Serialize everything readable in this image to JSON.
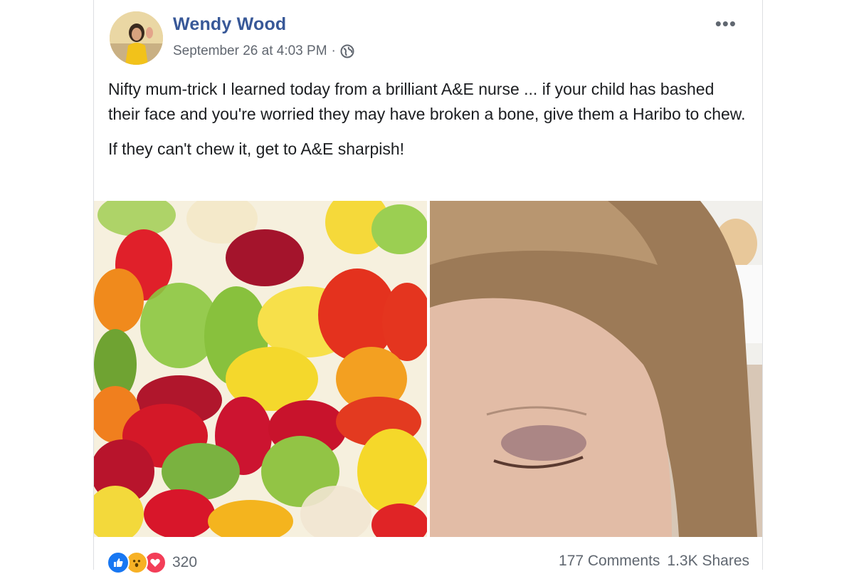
{
  "post": {
    "author": "Wendy Wood",
    "timestamp": "September 26 at 4:03 PM",
    "separator": "·",
    "audience_icon": "globe-icon",
    "more_icon": "•••",
    "body_line1": "Nifty mum-trick I learned today from a brilliant A&E nurse ... if your child has bashed their face and you're worried they may have broken a bone, give them a Haribo to chew.",
    "body_line2": "If they can't chew it, get to A&E sharpish!"
  },
  "photos": [
    {
      "icon": "gummy-bears-photo"
    },
    {
      "icon": "bruised-eye-child-photo"
    }
  ],
  "footer": {
    "reaction_icons": [
      "like-icon",
      "wow-icon",
      "love-icon"
    ],
    "reaction_count": "320",
    "comments": "177 Comments",
    "shares": "1.3K Shares"
  },
  "colors": {
    "author_link": "#385898",
    "meta_text": "#616770",
    "like": "#1877f2",
    "wow": "#f7b125",
    "love": "#f33e58"
  }
}
